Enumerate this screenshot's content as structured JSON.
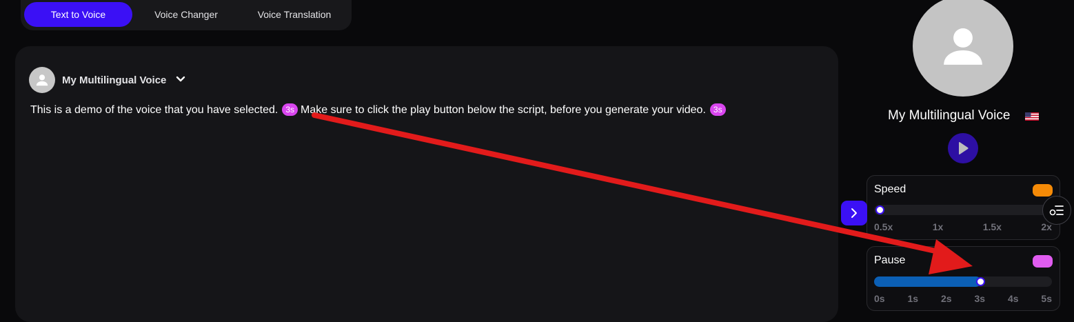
{
  "tabs": [
    {
      "label": "Text to Voice",
      "active": true
    },
    {
      "label": "Voice Changer",
      "active": false
    },
    {
      "label": "Voice Translation",
      "active": false
    }
  ],
  "editor": {
    "voice_selector": {
      "name": "My Multilingual Voice",
      "icon": "chevron-down-icon"
    },
    "script": {
      "segment_1": "This is a demo of the voice that you have selected.",
      "pause_1": "3s",
      "segment_2": "Make sure to click the play button below the script, before you generate your video.",
      "pause_2": "3s"
    }
  },
  "voice_panel": {
    "voice_name": "My Multilingual Voice",
    "flag": "us-flag-icon",
    "play_icon": "play-icon"
  },
  "speed": {
    "title": "Speed",
    "color": "#f58a07",
    "value": "0.5x",
    "ticks": [
      "0.5x",
      "1x",
      "1.5x",
      "2x"
    ]
  },
  "pause": {
    "title": "Pause",
    "color": "#e05cf0",
    "value": "3s",
    "ticks": [
      "0s",
      "1s",
      "2s",
      "3s",
      "4s",
      "5s"
    ]
  },
  "colors": {
    "accent": "#3b10f5",
    "pause_tag": "#d946ef",
    "annotation_arrow": "#e21b1b"
  }
}
